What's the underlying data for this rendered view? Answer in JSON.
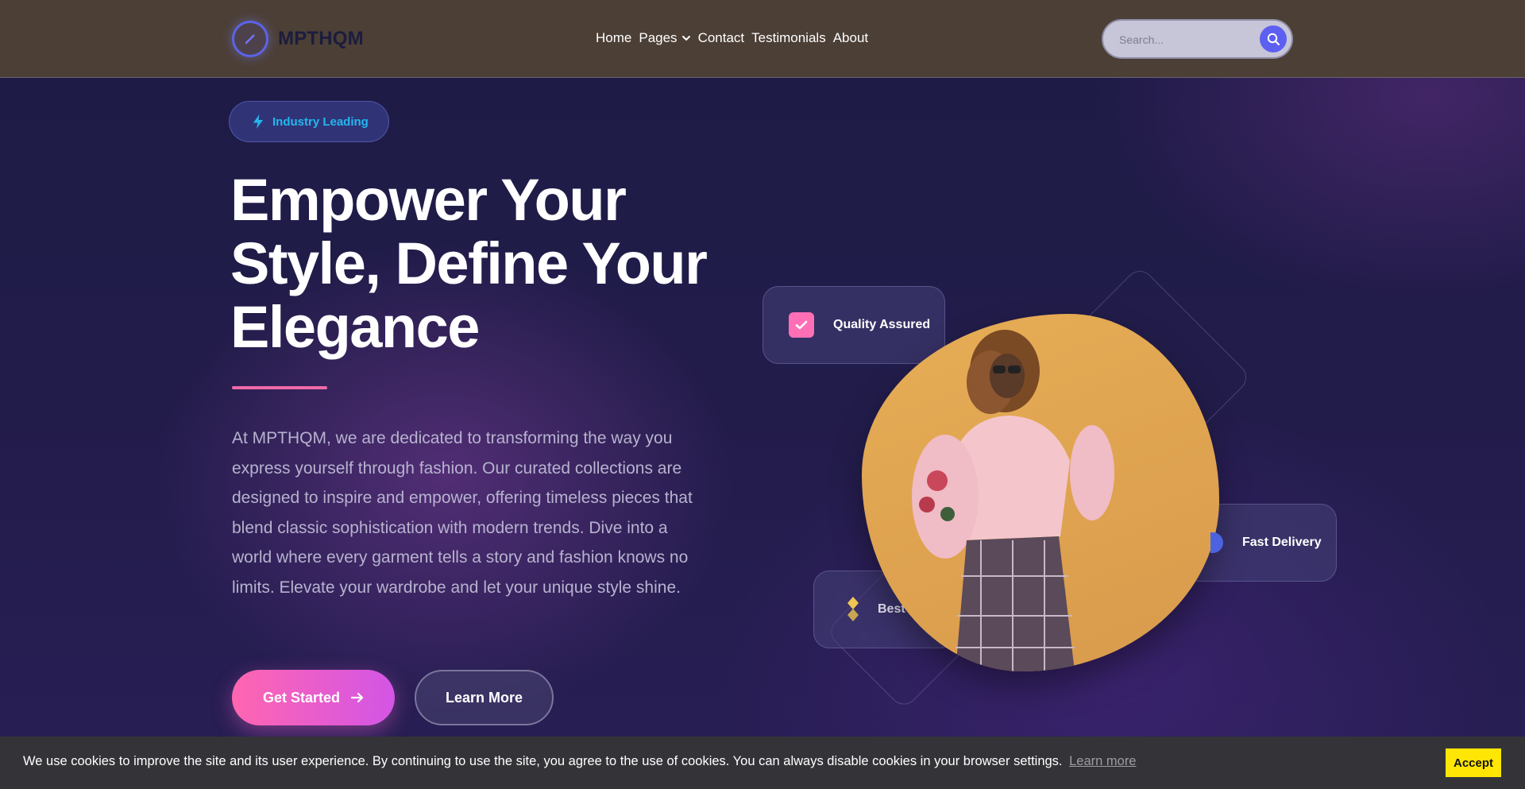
{
  "brand": {
    "name": "MPTHQM"
  },
  "nav": {
    "items": [
      {
        "label": "Home"
      },
      {
        "label": "Pages",
        "has_dropdown": true
      },
      {
        "label": "Contact"
      },
      {
        "label": "Testimonials"
      },
      {
        "label": "About"
      }
    ]
  },
  "search": {
    "placeholder": "Search...",
    "icon": "search-icon"
  },
  "hero": {
    "badge": {
      "label": "Industry Leading",
      "icon": "lightning-icon"
    },
    "title_lines": [
      "Empower Your",
      "Style, Define Your",
      "Elegance"
    ],
    "description": "At MPTHQM, we are dedicated to transforming the way you express yourself through fashion. Our curated collections are designed to inspire and empower, offering timeless pieces that blend classic sophistication with modern trends. Dive into a world where every garment tells a story and fashion knows no limits. Elevate your wardrobe and let your unique style shine.",
    "primary_button": "Get Started",
    "secondary_button": "Learn More"
  },
  "feature_cards": {
    "quality": {
      "label": "Quality Assured",
      "icon": "check-icon"
    },
    "delivery": {
      "label": "Fast Delivery",
      "icon": "truck-icon"
    },
    "best": {
      "label": "Best",
      "icon": "diamond-icon"
    }
  },
  "cookie": {
    "message": "We use cookies to improve the site and its user experience. By continuing to use the site, you agree to the use of cookies. You can always disable cookies in your browser settings.",
    "learn_more": "Learn more",
    "accept": "Accept"
  },
  "colors": {
    "accent_pink": "#ff66b0",
    "accent_purple": "#d355e6",
    "accent_blue": "#5d5ff0",
    "badge_text": "#23b7f0",
    "header_bg": "#4c3f36",
    "cookie_accept": "#ffe604"
  }
}
